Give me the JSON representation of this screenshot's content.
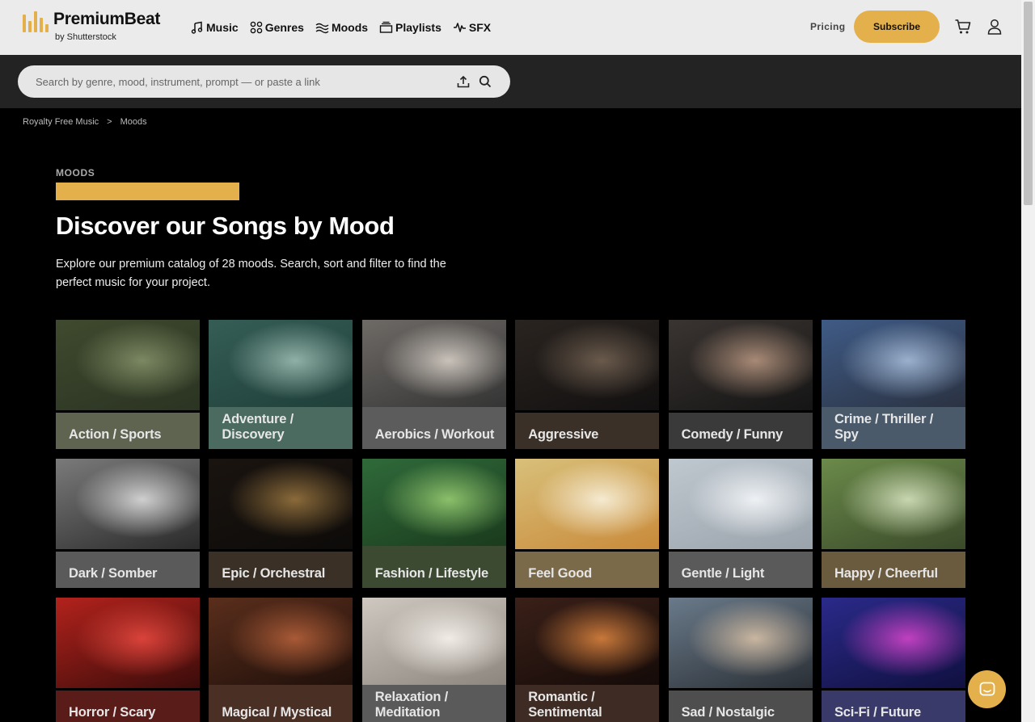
{
  "brand": {
    "name": "PremiumBeat",
    "sub": "by Shutterstock",
    "accent": "#e3b04b"
  },
  "nav": [
    {
      "label": "Music",
      "icon": "music-note-icon"
    },
    {
      "label": "Genres",
      "icon": "genres-grid-icon"
    },
    {
      "label": "Moods",
      "icon": "moods-waves-icon"
    },
    {
      "label": "Playlists",
      "icon": "playlists-icon"
    },
    {
      "label": "SFX",
      "icon": "sfx-waveform-icon"
    }
  ],
  "header": {
    "pricing_label": "Pricing",
    "subscribe_label": "Subscribe",
    "cart_icon": "cart-icon",
    "user_icon": "user-icon"
  },
  "search": {
    "placeholder": "Search by genre, mood, instrument, prompt — or paste a link",
    "value": ""
  },
  "breadcrumb": {
    "root": "Royalty Free Music",
    "separator": ">",
    "current": "Moods"
  },
  "hero": {
    "eyebrow": "MOODS",
    "title": "Discover our Songs by Mood",
    "intro": "Explore our premium catalog of 28 moods. Search, sort and filter to find the perfect music for your project."
  },
  "moods": [
    {
      "label": "Action / Sports",
      "band": "#5e6450",
      "img": [
        "#3f4a2e",
        "#7b8862",
        "#2b3322"
      ]
    },
    {
      "label": "Adventure / Discovery",
      "band": "#4c6b60",
      "img": [
        "#355d56",
        "#8fb0a6",
        "#1f3f39"
      ]
    },
    {
      "label": "Aerobics / Workout",
      "band": "#5c5c5c",
      "img": [
        "#6e6a66",
        "#c9c2ba",
        "#333"
      ]
    },
    {
      "label": "Aggressive",
      "band": "#3a3028",
      "img": [
        "#2a2420",
        "#6a5a4c",
        "#121010"
      ]
    },
    {
      "label": "Comedy / Funny",
      "band": "#3a3a3a",
      "img": [
        "#3a3431",
        "#a88a76",
        "#151515"
      ]
    },
    {
      "label": "Crime / Thriller / Spy",
      "band": "#4a5a6a",
      "img": [
        "#3f5b86",
        "#9ab0cd",
        "#2a3140"
      ]
    },
    {
      "label": "Dark / Somber",
      "band": "#5a5a5a",
      "img": [
        "#7a7a7a",
        "#cfcfcf",
        "#2a2a2a"
      ]
    },
    {
      "label": "Epic / Orchestral",
      "band": "#3a3026",
      "img": [
        "#1a1410",
        "#8a6a3a",
        "#0d0b09"
      ]
    },
    {
      "label": "Fashion / Lifestyle",
      "band": "#3c4a32",
      "img": [
        "#2f6a3a",
        "#8bbf6a",
        "#1a3a1c"
      ]
    },
    {
      "label": "Feel Good",
      "band": "#7a6a4a",
      "img": [
        "#d8c07a",
        "#f5ead0",
        "#c98a3a"
      ]
    },
    {
      "label": "Gentle / Light",
      "band": "#5a5a5a",
      "img": [
        "#bfc7cf",
        "#eef1f4",
        "#9aa3ab"
      ]
    },
    {
      "label": "Happy / Cheerful",
      "band": "#6a5a3e",
      "img": [
        "#6b8a4a",
        "#c8d6b0",
        "#3a4a2a"
      ]
    },
    {
      "label": "Horror / Scary",
      "band": "#5a1c18",
      "img": [
        "#b3221c",
        "#d9433a",
        "#3a0c0a"
      ]
    },
    {
      "label": "Magical / Mystical",
      "band": "#4a3024",
      "img": [
        "#5a2e1c",
        "#a85a36",
        "#1e0f0a"
      ]
    },
    {
      "label": "Relaxation / Meditation",
      "band": "#5a5a5a",
      "img": [
        "#cfc8c0",
        "#f0ece6",
        "#8a847c"
      ]
    },
    {
      "label": "Romantic / Sentimental",
      "band": "#3e2c24",
      "img": [
        "#3a2018",
        "#c8783a",
        "#140a08"
      ]
    },
    {
      "label": "Sad / Nostalgic",
      "band": "#4e4e4e",
      "img": [
        "#6a7a8a",
        "#c9b6a0",
        "#2a2f35"
      ]
    },
    {
      "label": "Sci-Fi / Future",
      "band": "#3a3a6a",
      "img": [
        "#2a2a8a",
        "#c040c0",
        "#101040"
      ]
    }
  ],
  "chat": {
    "icon": "chat-bubble-icon"
  }
}
